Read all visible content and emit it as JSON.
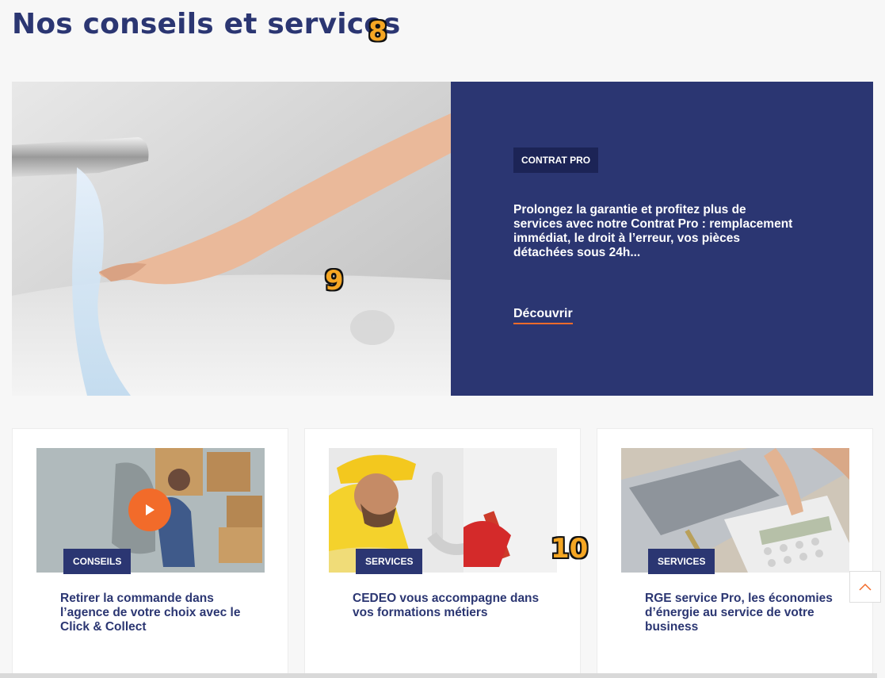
{
  "section": {
    "title": "Nos conseils et services",
    "badge": "8"
  },
  "hero": {
    "badge": "9",
    "tag": "CONTRAT PRO",
    "text": "Prolongez la garantie et profitez plus de services avec notre Contrat Pro : remplacement immédiat, le droit à l’erreur, vos pièces détachées sous 24h...",
    "link_label": "Découvrir",
    "image_icon": "faucet-water-hand-image"
  },
  "cards": [
    {
      "tag": "CONSEILS",
      "title": "Retirer la commande dans l’agence de votre choix avec le Click & Collect",
      "image_icon": "warehouse-worker-image",
      "has_play": true
    },
    {
      "tag": "SERVICES",
      "title": "CEDEO vous accompagne dans vos formations métiers",
      "image_icon": "plumber-image",
      "badge": "10"
    },
    {
      "tag": "SERVICES",
      "title": "RGE service Pro, les économies d’énergie au service de votre business",
      "image_icon": "calculator-laptop-image"
    }
  ],
  "scroll_top": {
    "icon": "chevron-up-icon"
  },
  "colors": {
    "brand_navy": "#2b3672",
    "accent_orange": "#f26b2a",
    "tag_dark": "#1c2456"
  }
}
